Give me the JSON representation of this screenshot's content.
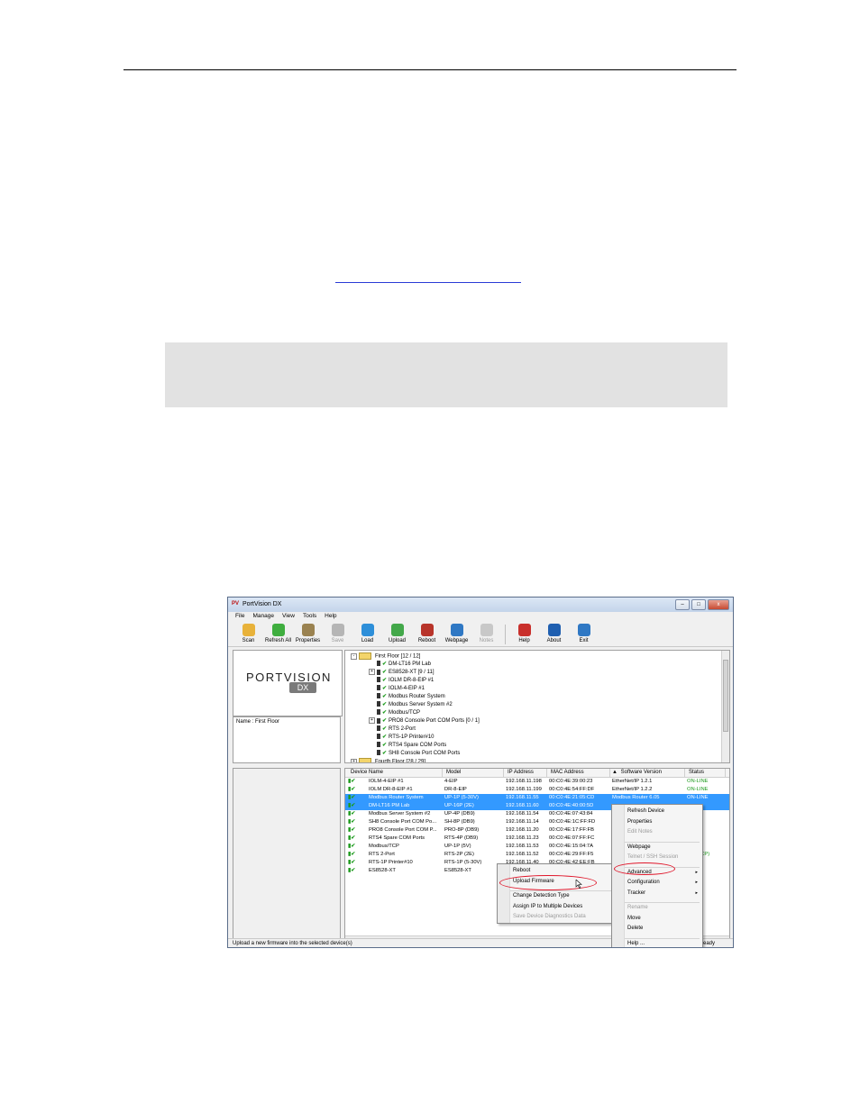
{
  "window": {
    "title": "PortVision DX",
    "app_icon": "PV",
    "buttons": [
      "–",
      "□",
      "x"
    ]
  },
  "menu": [
    "File",
    "Manage",
    "View",
    "Tools",
    "Help"
  ],
  "toolbar": [
    {
      "label": "Scan",
      "icon": "scan-icon",
      "color": "#e8b23a",
      "disabled": false
    },
    {
      "label": "Refresh All",
      "icon": "refresh-icon",
      "color": "#3fae3f",
      "disabled": false
    },
    {
      "label": "Properties",
      "icon": "properties-icon",
      "color": "#9a8250",
      "disabled": false
    },
    {
      "label": "Save",
      "icon": "save-icon",
      "color": "#b5b5b5",
      "disabled": true
    },
    {
      "label": "Load",
      "icon": "load-icon",
      "color": "#2e8fd9",
      "disabled": false
    },
    {
      "label": "Upload",
      "icon": "upload-icon",
      "color": "#43a84a",
      "disabled": false
    },
    {
      "label": "Reboot",
      "icon": "reboot-icon",
      "color": "#b8342a",
      "disabled": false
    },
    {
      "label": "Webpage",
      "icon": "webpage-icon",
      "color": "#2f78c4",
      "disabled": false
    },
    {
      "label": "Notes",
      "icon": "notes-icon",
      "color": "#c8c8c8",
      "disabled": true
    },
    {
      "label": "Help",
      "icon": "help-icon",
      "color": "#c9302c",
      "disabled": false
    },
    {
      "label": "About",
      "icon": "about-icon",
      "color": "#1f5fb0",
      "disabled": false
    },
    {
      "label": "Exit",
      "icon": "exit-icon",
      "color": "#2f78c4",
      "disabled": false
    }
  ],
  "logo": {
    "text": "PORTVISION",
    "sub": "DX"
  },
  "name_pane": "Name : First Floor",
  "tree": [
    {
      "label": "First Floor [12 / 12]",
      "kind": "folder",
      "expander": "-"
    },
    {
      "label": "DM-LT16 PM Lab",
      "kind": "device"
    },
    {
      "label": "ES8528-XT [9 / 11]",
      "kind": "device",
      "expander": "+"
    },
    {
      "label": "IOLM DR-8-EIP #1",
      "kind": "device"
    },
    {
      "label": "IOLM-4-EIP #1",
      "kind": "device"
    },
    {
      "label": "Modbus Router System",
      "kind": "device"
    },
    {
      "label": "Modbus Server System #2",
      "kind": "device"
    },
    {
      "label": "Modbus/TCP",
      "kind": "device"
    },
    {
      "label": "PRO8 Console Port COM Ports [0 / 1]",
      "kind": "device",
      "expander": "+"
    },
    {
      "label": "RTS 2-Port",
      "kind": "device"
    },
    {
      "label": "RTS-1P Printer#10",
      "kind": "device"
    },
    {
      "label": "RTS4 Spare COM Ports",
      "kind": "device"
    },
    {
      "label": "SH8 Console Port COM Ports",
      "kind": "device"
    },
    {
      "label": "Fourth Floor [28 / 29]",
      "kind": "folder",
      "expander": "+"
    }
  ],
  "columns": [
    "Device Name",
    "Model",
    "IP Address",
    "MAC Address",
    "Software Version",
    "Status"
  ],
  "rows": [
    {
      "name": "IOLM-4-EIP #1",
      "model": "4-EIP",
      "ip": "192.168.11.198",
      "mac": "00:C0:4E:39:00:23",
      "sw": "EtherNet/IP 1.2.1",
      "status": "ON-LINE",
      "sel": false
    },
    {
      "name": "IOLM DR-8-EIP #1",
      "model": "DR-8-EIP",
      "ip": "192.168.11.199",
      "mac": "00:C0:4E:54:FF:DF",
      "sw": "EtherNet/IP 1.2.2",
      "status": "ON-LINE",
      "sel": false
    },
    {
      "name": "Modbus Router System",
      "model": "UP-1P (5-30V)",
      "ip": "192.168.11.55",
      "mac": "00:C0:4E:21:05:CD",
      "sw": "Modbus Router 6.05",
      "status": "ON-LINE",
      "sel": true
    },
    {
      "name": "DM-LT16 PM Lab",
      "model": "UP-16P (2E)",
      "ip": "192.168.11.60",
      "mac": "00:C0:4E:40:00:5D",
      "sw": "",
      "status": "",
      "sel": true
    },
    {
      "name": "Modbus Server System #2",
      "model": "UP-4P (DB9)",
      "ip": "192.168.11.54",
      "mac": "00:C0:4E:07:43:84",
      "sw": "",
      "status": "NE",
      "sel": false
    },
    {
      "name": "SH8 Console Port COM Po...",
      "model": "SH-8P (DB9)",
      "ip": "192.168.11.14",
      "mac": "00:C0:4E:1C:FF:FD",
      "sw": "",
      "status": "NE",
      "sel": false
    },
    {
      "name": "PRO8 Console Port COM P...",
      "model": "PRO-8P (DB9)",
      "ip": "192.168.11.20",
      "mac": "00:C0:4E:17:FF:FB",
      "sw": "",
      "status": "NE",
      "sel": false
    },
    {
      "name": "RTS4 Spare COM Ports",
      "model": "RTS-4P (DB9)",
      "ip": "192.168.11.23",
      "mac": "00:C0:4E:07:FF:FC",
      "sw": "",
      "status": "NE",
      "sel": false
    },
    {
      "name": "Modbus/TCP",
      "model": "UP-1P (5V)",
      "ip": "192.168.11.53",
      "mac": "00:C0:4E:15:04:7A",
      "sw": "",
      "status": "NE",
      "sel": false
    },
    {
      "name": "RTS 2-Port",
      "model": "RTS-2P (2E)",
      "ip": "192.168.11.52",
      "mac": "00:C0:4E:29:FF:F5",
      "sw": "",
      "status": "NE (TCP)",
      "sel": false
    },
    {
      "name": "RTS-1P Printer#10",
      "model": "RTS-1P (5-30V)",
      "ip": "192.168.11.40",
      "mac": "00:C0:4E:42:EE:FB",
      "sw": "",
      "status": "NE",
      "sel": false
    },
    {
      "name": "ES8528-XT",
      "model": "ES8528-XT",
      "ip": "",
      "mac": "",
      "sw": "",
      "status": "NE",
      "sel": false
    }
  ],
  "ctx_main": [
    {
      "label": "Refresh Device",
      "disabled": false
    },
    {
      "label": "Properties",
      "disabled": false
    },
    {
      "label": "Edit Notes",
      "disabled": true
    },
    {
      "sep": true
    },
    {
      "label": "Webpage",
      "disabled": false
    },
    {
      "label": "Telnet / SSH Session",
      "disabled": true
    },
    {
      "sep": true
    },
    {
      "label": "Advanced",
      "disabled": false,
      "sub": true
    },
    {
      "label": "Configuration",
      "disabled": false,
      "sub": true
    },
    {
      "label": "Tracker",
      "disabled": false,
      "sub": true
    },
    {
      "sep": true
    },
    {
      "label": "Rename",
      "disabled": true
    },
    {
      "label": "Move",
      "disabled": false
    },
    {
      "label": "Delete",
      "disabled": false
    },
    {
      "sep": true
    },
    {
      "label": "Help ...",
      "disabled": false
    }
  ],
  "ctx_sub": [
    {
      "label": "Reboot",
      "disabled": false
    },
    {
      "label": "Upload Firmware",
      "disabled": false
    },
    {
      "sep": true
    },
    {
      "label": "Change Detection Type",
      "disabled": false
    },
    {
      "label": "Assign IP to Multiple Devices",
      "disabled": false
    },
    {
      "label": "Save Device Diagnostics Data",
      "disabled": true
    }
  ],
  "status": {
    "left": "Upload a new firmware into the selected device(s)",
    "right": "eady"
  },
  "colors": {
    "selection": "#3399ff",
    "online": "#1c9a1c",
    "highlight": "#e0182c"
  }
}
